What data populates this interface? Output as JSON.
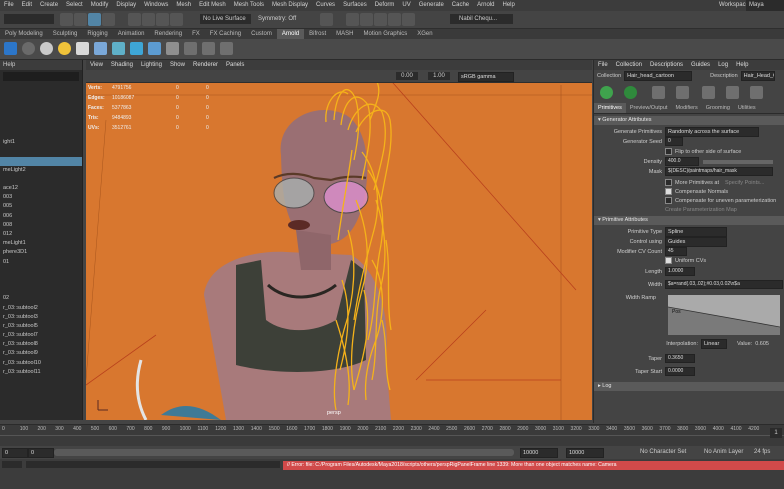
{
  "menubar": {
    "items": [
      "File",
      "Edit",
      "Create",
      "Select",
      "Modify",
      "Display",
      "Windows",
      "Mesh",
      "Edit Mesh",
      "Mesh Tools",
      "Mesh Display",
      "Curves",
      "Surfaces",
      "Deform",
      "UV",
      "Generate",
      "Cache",
      "Arnold",
      "Help"
    ],
    "workspace_label": "Workspace :",
    "workspace_value": "Maya Classic"
  },
  "statusline": {
    "live_surface": "No Live Surface",
    "symmetry": "Symmetry: Off",
    "user": "Nabil Chequ..."
  },
  "shelf_tabs": [
    "Poly Modeling",
    "Sculpting",
    "Rigging",
    "Animation",
    "Rendering",
    "FX",
    "FX Caching",
    "Custom",
    "Arnold",
    "Bifrost",
    "MASH",
    "Motion Graphics",
    "XGen"
  ],
  "shelf_active": "Arnold",
  "outliner": {
    "menu": "Help",
    "rows": [
      "",
      "",
      "",
      "",
      "",
      "",
      "ight1",
      "",
      "",
      "meLight2",
      "",
      "ace12",
      "003",
      "005",
      "006",
      "008",
      "012",
      "meLight1",
      "phere3D1",
      "01",
      "",
      "",
      "",
      "02",
      "r_03::subtool2",
      "r_03::subtool3",
      "r_03::subtool5",
      "r_03::subtool7",
      "r_03::subtool8",
      "r_03::subtool9",
      "r_03::subtool10",
      "r_03::subtool11"
    ],
    "selected_index": 8
  },
  "viewport": {
    "menu": [
      "View",
      "Shading",
      "Lighting",
      "Show",
      "Renderer",
      "Panels"
    ],
    "field1": "0.00",
    "field2": "1.00",
    "colorspace": "sRGB gamma",
    "camera_label": "persp",
    "hud": [
      {
        "k": "Verts:",
        "v": "4791756",
        "a": "0",
        "b": "0"
      },
      {
        "k": "Edges:",
        "v": "10186087",
        "a": "0",
        "b": "0"
      },
      {
        "k": "Faces:",
        "v": "5377863",
        "a": "0",
        "b": "0"
      },
      {
        "k": "Tris:",
        "v": "9484893",
        "a": "0",
        "b": "0"
      },
      {
        "k": "UVs:",
        "v": "3512761",
        "a": "0",
        "b": "0"
      }
    ]
  },
  "xgen": {
    "menu": [
      "File",
      "Collection",
      "Descriptions",
      "Guides",
      "Log",
      "Help"
    ],
    "collection_label": "Collection",
    "collection_value": "Hair_head_cartoon",
    "description_label": "Description",
    "description_value": "Hair_Head_Ca",
    "tabs": [
      "Primitives",
      "Preview/Output",
      "Modifiers",
      "Grooming",
      "Utilities"
    ],
    "generator_section": "Generator Attributes",
    "generate_primitives_label": "Generate Primitives",
    "generate_primitives_value": "Randomly across the surface",
    "generator_seed_label": "Generator Seed",
    "generator_seed_value": "0",
    "flip_label": "Flip to other side of surface",
    "density_label": "Density",
    "density_value": "400.0",
    "mask_label": "Mask",
    "mask_value": "${DESC}/paintmaps/hair_mask",
    "more_primitives": "More Primitives at",
    "specify_points": "Specify Points...",
    "compensate_normals": "Compensate Normals",
    "compensate_uneven": "Compensate for uneven parameterization",
    "create_param_map": "Create Parameterization Map",
    "primitive_section": "Primitive Attributes",
    "primitive_type_label": "Primitive Type",
    "primitive_type_value": "Spline",
    "control_using_label": "Control using",
    "control_using_value": "Guides",
    "modifier_cv_label": "Modifier CV Count",
    "modifier_cv_value": "45",
    "uniform_cvs": "Uniform CVs",
    "length_label": "Length",
    "length_value": "1.0000",
    "width_label": "Width",
    "width_value": "$a=rand(.03,.02);#0.03,0.02\\n$a",
    "width_ramp_label": "Width Ramp",
    "interpolation_label": "Interpolation:",
    "interpolation_value": "Linear",
    "value_label": "Value:",
    "value_value": "0.605",
    "position_label": "Pos",
    "taper_label": "Taper",
    "taper_value": "0.3650",
    "taper_start_label": "Taper Start",
    "taper_start_value": "0.0000",
    "log_label": "Log"
  },
  "timeline": {
    "ticks": [
      "0",
      "100",
      "200",
      "300",
      "400",
      "500",
      "600",
      "700",
      "800",
      "900",
      "1000",
      "1100",
      "1200",
      "1300",
      "1400",
      "1500",
      "1600",
      "1700",
      "1800",
      "1900",
      "2000",
      "2100",
      "2200",
      "2300",
      "2400",
      "2500",
      "2600",
      "2700",
      "2800",
      "2900",
      "3000",
      "3100",
      "3200",
      "3300",
      "3400",
      "3500",
      "3600",
      "3700",
      "3800",
      "3900",
      "4000",
      "4100",
      "4200"
    ],
    "current": "1"
  },
  "range": {
    "start": "0",
    "anim_start": "0",
    "range_start": "10000",
    "range_end": "10000",
    "anim_end": "10000",
    "character_set": "No Character Set",
    "anim_layer": "No Anim Layer",
    "fps": "24 fps"
  },
  "cmdline": {
    "error": "// Error: file: C:/Program Files/Autodesk/Maya2018/scripts/others/perspRigPanelFrame line 1339: More than one object matches name: Camera"
  },
  "colors": {
    "viewport_bg": "#d8772f",
    "hair": "#f5b21a",
    "selection": "#5285a6",
    "error": "#d14a4a"
  }
}
